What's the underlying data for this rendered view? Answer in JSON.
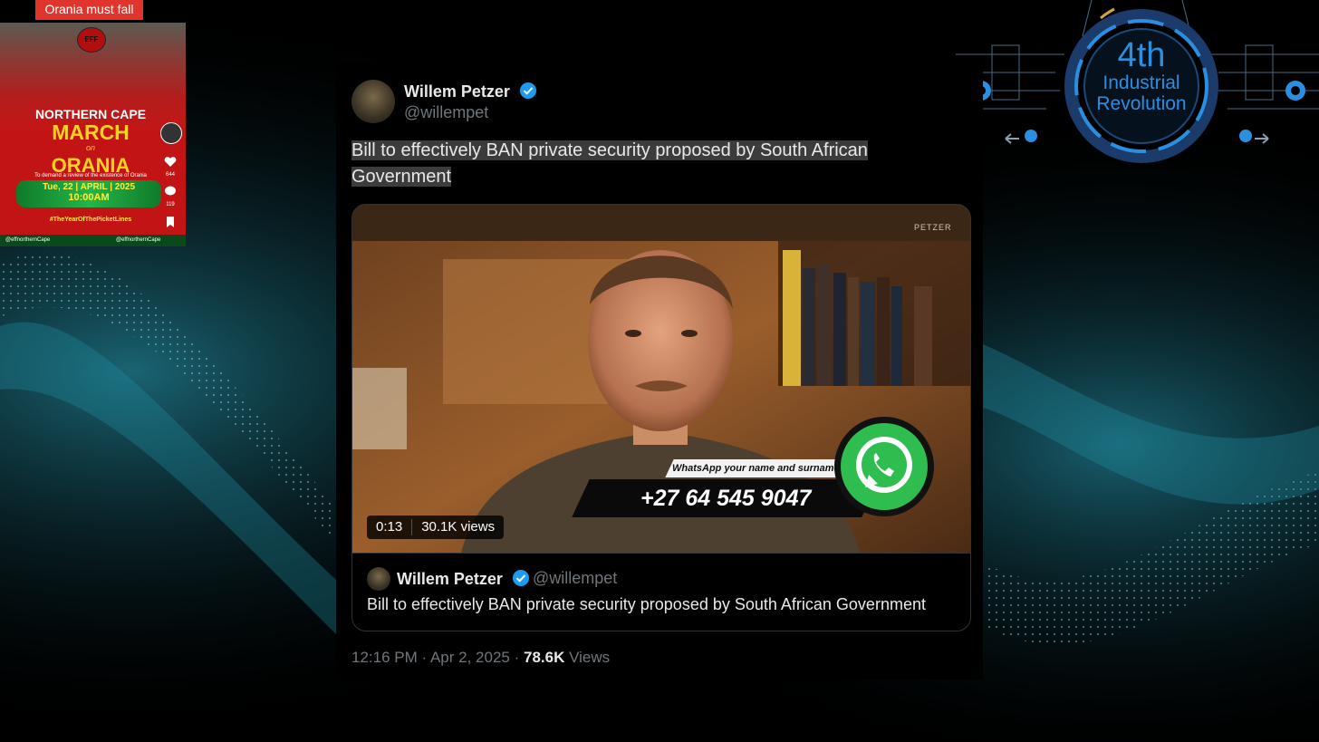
{
  "poster": {
    "tag": "Orania must fall",
    "logo_text": "EFF",
    "line1": "NORTHERN CAPE",
    "line2": "MARCH",
    "line3": "on",
    "line4": "ORANIA",
    "line5": "To demand a review of the existence of Orania",
    "date": "Tue, 22 | APRIL | 2025",
    "time": "10:00AM",
    "hashtag": "#TheYearOfThePicketLines",
    "footer_left": "@effnorthernCape",
    "footer_right": "@effnorthernCape",
    "likes": "644",
    "comments": "119"
  },
  "ir_logo": {
    "line1": "4th",
    "line2": "Industrial",
    "line3": "Revolution"
  },
  "tweet": {
    "author_name": "Willem Petzer",
    "author_handle": "@willempet",
    "text": "Bill to effectively BAN private security proposed by South African Government",
    "video": {
      "watermark": "PETZER",
      "duration": "0:13",
      "views": "30.1K views",
      "whatsapp_label": "WhatsApp your name and surname",
      "whatsapp_number": "+27 64 545 9047"
    },
    "quote": {
      "author_name": "Willem Petzer",
      "author_handle": "@willempet",
      "text": "Bill to effectively BAN private security proposed by South African Government"
    },
    "meta": {
      "time": "12:16 PM",
      "sep1": "·",
      "date": "Apr 2, 2025",
      "sep2": "·",
      "views_count": "78.6K",
      "views_label": "Views"
    }
  },
  "colors": {
    "background": "#000000",
    "teal_wave": "#2fb7c9",
    "verified_blue": "#1d9bf0",
    "muted_text": "#71767b",
    "primary_text": "#e7e9ea",
    "poster_red": "#c21414",
    "whatsapp_green": "#25d366"
  }
}
